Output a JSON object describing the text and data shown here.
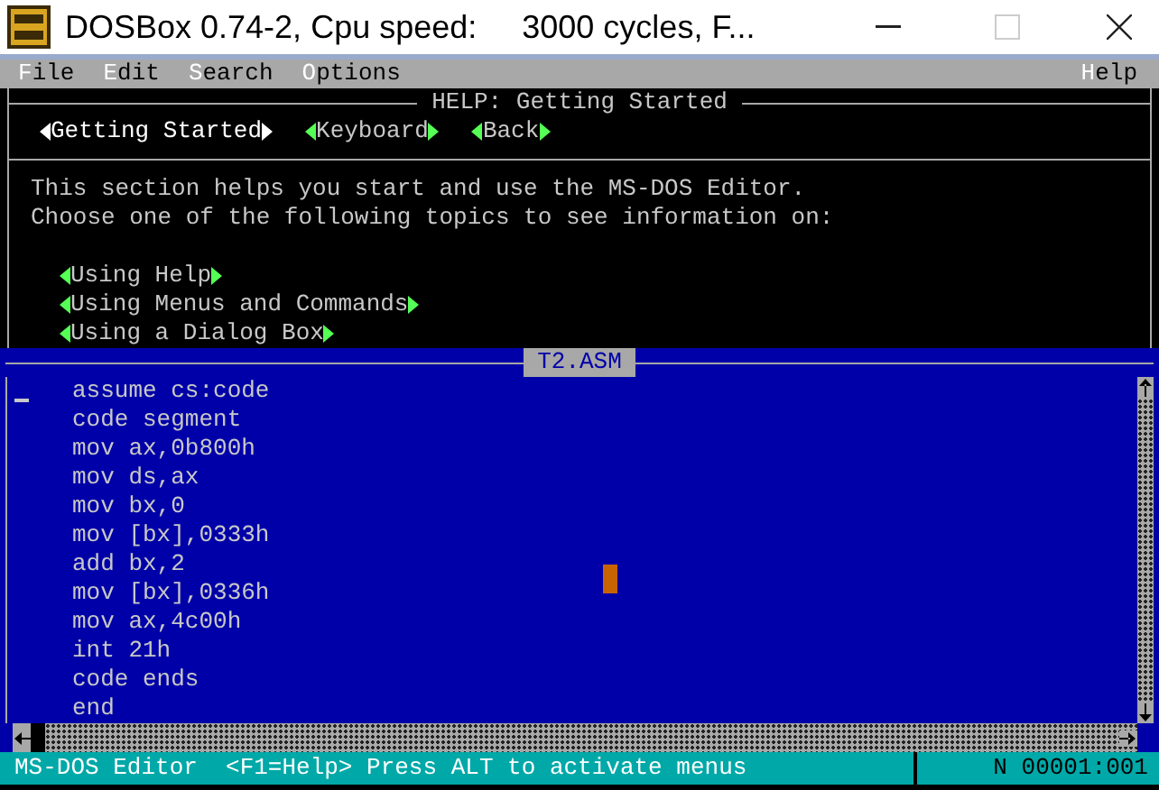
{
  "window": {
    "title": "DOSBox 0.74-2, Cpu speed:     3000 cycles, F..."
  },
  "menu": {
    "left": [
      {
        "label": "File"
      },
      {
        "label": "Edit"
      },
      {
        "label": "Search"
      },
      {
        "label": "Options"
      }
    ],
    "right": [
      {
        "label": "Help"
      }
    ]
  },
  "help": {
    "title": "HELP: Getting Started",
    "nav": [
      {
        "label": "Getting Started",
        "selected": true
      },
      {
        "label": "Keyboard",
        "selected": false
      },
      {
        "label": "Back",
        "selected": false
      }
    ],
    "lines": [
      "This section helps you start and use the MS-DOS Editor.",
      "Choose one of the following topics to see information on:"
    ],
    "topics": [
      "Using Help",
      "Using Menus and Commands",
      "Using a Dialog Box"
    ]
  },
  "editor": {
    "title": "T2.ASM",
    "lines": [
      "assume cs:code",
      "code segment",
      "mov ax,0b800h",
      "mov ds,ax",
      "mov bx,0",
      "mov [bx],0333h",
      "add bx,2",
      "mov [bx],0336h",
      "mov ax,4c00h",
      "int 21h",
      "code ends",
      "end"
    ]
  },
  "status": {
    "message": "MS-DOS Editor  <F1=Help> Press ALT to activate menus",
    "position": "N 00001:001"
  }
}
